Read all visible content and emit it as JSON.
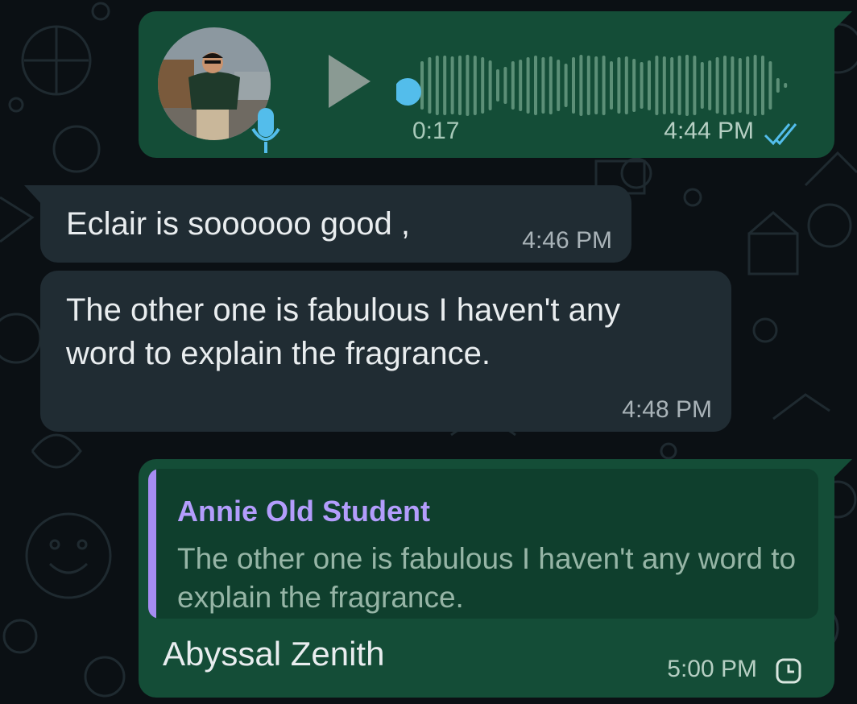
{
  "chat": {
    "voice_message": {
      "duration": "0:17",
      "time": "4:44 PM",
      "status_icon": "double-check-read-icon",
      "progress": 0
    },
    "incoming_1": {
      "text": "Eclair is soooooo good ,",
      "time": "4:46 PM"
    },
    "incoming_2": {
      "text": "The other one is fabulous I haven't any word to explain the fragrance.",
      "time": "4:48 PM"
    },
    "reply": {
      "quoted_author": "Annie Old Student",
      "quoted_text": "The other one is fabulous I haven't any word to explain the fragrance.",
      "text": "Abyssal Zenith",
      "time": "5:00 PM",
      "status_icon": "clock-pending-icon"
    }
  },
  "colors": {
    "background": "#0b1014",
    "outgoing_bubble": "#144d37",
    "incoming_bubble": "#202c33",
    "accent_blue": "#53bdeb",
    "quote_bar": "#a68cf2"
  }
}
